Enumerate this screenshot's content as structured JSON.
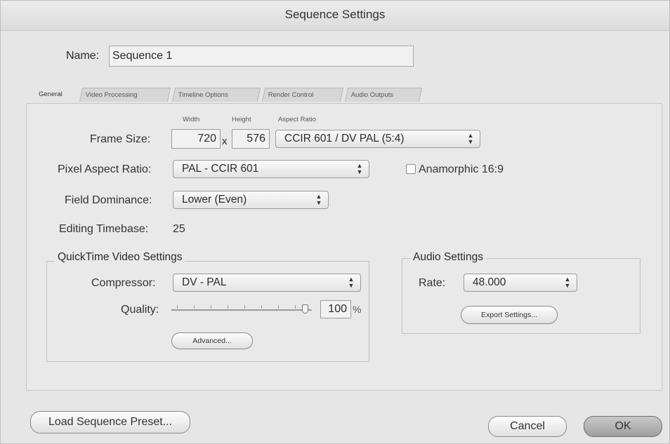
{
  "window": {
    "title": "Sequence Settings"
  },
  "name_field": {
    "label": "Name:",
    "value": "Sequence 1"
  },
  "tabs": [
    {
      "label": "General",
      "active": true
    },
    {
      "label": "Video Processing",
      "active": false
    },
    {
      "label": "Timeline Options",
      "active": false
    },
    {
      "label": "Render Control",
      "active": false
    },
    {
      "label": "Audio Outputs",
      "active": false
    }
  ],
  "general": {
    "frame_size": {
      "label": "Frame Size:",
      "width_caption": "Width",
      "height_caption": "Height",
      "aspect_caption": "Aspect Ratio",
      "width": "720",
      "separator": "x",
      "height": "576",
      "aspect_ratio": "CCIR 601 / DV PAL (5:4)"
    },
    "pixel_aspect": {
      "label": "Pixel Aspect Ratio:",
      "value": "PAL - CCIR 601"
    },
    "anamorphic": {
      "label": "Anamorphic 16:9",
      "checked": false
    },
    "field_dominance": {
      "label": "Field Dominance:",
      "value": "Lower (Even)"
    },
    "editing_timebase": {
      "label": "Editing Timebase:",
      "value": "25"
    }
  },
  "quicktime": {
    "title": "QuickTime Video Settings",
    "compressor_label": "Compressor:",
    "compressor": "DV - PAL",
    "quality_label": "Quality:",
    "quality_value": "100",
    "quality_unit": "%",
    "quality_fraction": 1.0,
    "advanced_label": "Advanced..."
  },
  "audio": {
    "title": "Audio Settings",
    "rate_label": "Rate:",
    "rate": "48.000",
    "export_label": "Export Settings..."
  },
  "footer": {
    "load_preset": "Load Sequence Preset...",
    "cancel": "Cancel",
    "ok": "OK"
  },
  "icons": {
    "popup_arrows": "up-down-chevrons-icon"
  }
}
